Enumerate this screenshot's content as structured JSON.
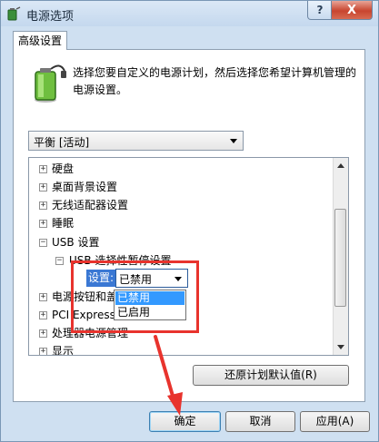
{
  "window": {
    "title": "电源选项",
    "help_glyph": "?",
    "close_glyph": "X"
  },
  "tab": {
    "label": "高级设置"
  },
  "description": "选择您要自定义的电源计划，然后选择您希望计算机管理的电源设置。",
  "plan_select": {
    "value": "平衡 [活动]"
  },
  "tree": {
    "rows": [
      {
        "exp": "+",
        "label": "硬盘"
      },
      {
        "exp": "+",
        "label": "桌面背景设置"
      },
      {
        "exp": "+",
        "label": "无线适配器设置"
      },
      {
        "exp": "+",
        "label": "睡眠"
      },
      {
        "exp": "−",
        "label": "USB 设置"
      },
      {
        "exp": "−",
        "label": "USB 选择性暂停设置"
      },
      {
        "exp": "+",
        "label": "电源按钮和盖"
      },
      {
        "exp": "+",
        "label": "PCI Express"
      },
      {
        "exp": "+",
        "label": "处理器电源管理"
      },
      {
        "exp": "+",
        "label": "显示"
      }
    ],
    "setting_label": "设置:",
    "setting_value": "已禁用",
    "options": [
      "已禁用",
      "已启用"
    ]
  },
  "buttons": {
    "restore": "还原计划默认值(R)",
    "ok": "确定",
    "cancel": "取消",
    "apply": "应用(A)"
  },
  "colors": {
    "annotation_red": "#e8332d",
    "selection_blue": "#3399ff"
  }
}
